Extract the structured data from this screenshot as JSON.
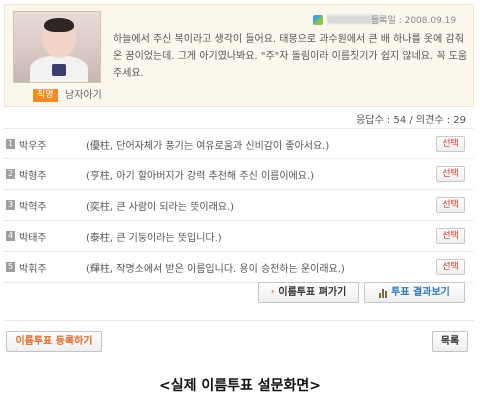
{
  "post": {
    "category_badge": "작명",
    "category_text": "남자아기",
    "registered": "등록일 : 2008.09.19",
    "body": "하늘에서 주신 복이라고 생각이 들어요. 태몽으로 과수원에서 큰 배 하나를 옷에 감춰 온 꿈이었는데. 그게 아기였나봐요. \"주\"자 돌림이라 이름짓기가 쉽지 않네요. 꼭 도움 주세요."
  },
  "stats": {
    "counts": "응답수 : 54 / 의견수 : 29"
  },
  "options": [
    {
      "num": "1",
      "name": "박우주",
      "desc": "(優柱, 단어자체가 풍기는 여유로움과 신비감이 좋아서요.)",
      "select": "선택"
    },
    {
      "num": "2",
      "name": "박형주",
      "desc": "(亨柱, 아기 할아버지가 강력 추천해 주신 이름이에요.)",
      "select": "선택"
    },
    {
      "num": "3",
      "name": "박혁주",
      "desc": "(奕柱, 큰 사람이 되라는 뜻이래요.)",
      "select": "선택"
    },
    {
      "num": "4",
      "name": "박태주",
      "desc": "(泰柱, 큰 기둥이라는 뜻입니다.)",
      "select": "선택"
    },
    {
      "num": "5",
      "name": "박휘주",
      "desc": "(輝柱, 작명소에서 받은 이름입니다. 용이 승천하는 운이래요.)",
      "select": "선택"
    }
  ],
  "buttons": {
    "go_vote": "이름투표 펴가기",
    "result": "투표 결과보기",
    "register": "이름투표 등록하기",
    "list": "목록"
  },
  "caption": "<실제 이름투표 설문화면>"
}
